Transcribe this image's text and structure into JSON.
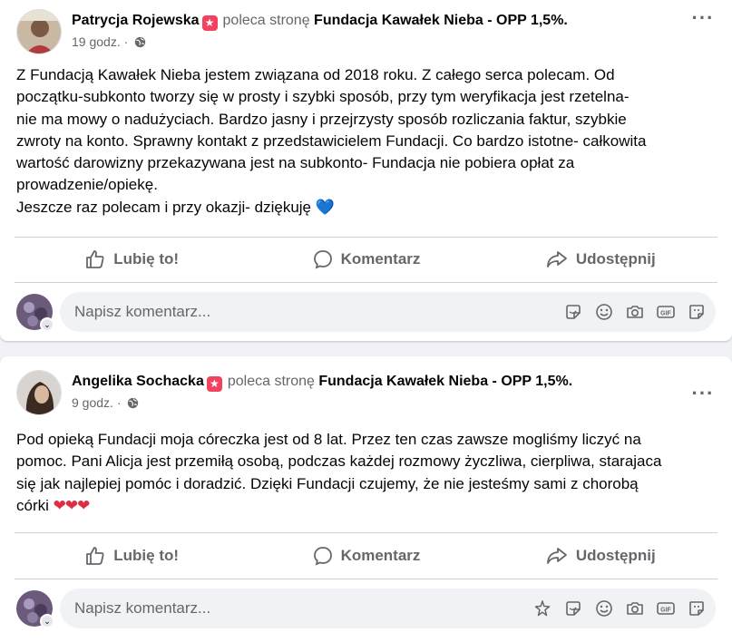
{
  "colors": {
    "background": "#f0f2f5",
    "card": "#ffffff",
    "text_primary": "#050505",
    "text_secondary": "#65676b",
    "badge": "#f3425f",
    "divider": "#ced0d4"
  },
  "posts": [
    {
      "author": "Patrycja Rojewska",
      "recommends_text": "poleca stronę",
      "page_name": "Fundacja Kawałek Nieba - OPP 1,5%.",
      "time": "19 godz. ·",
      "body_lines": [
        "Z Fundacją Kawałek Nieba jestem związana od 2018 roku. Z całego serca polecam. Od",
        "początku-subkonto tworzy się w prosty i szybki sposób, przy tym weryfikacja jest rzetelna-",
        "nie ma mowy o nadużyciach. Bardzo jasny i przejrzysty sposób rozliczania faktur, szybkie",
        "zwroty na konto. Sprawny kontakt z przedstawicielem Fundacji. Co bardzo istotne- całkowita",
        "wartość darowizny przekazywana jest na subkonto- Fundacja nie pobiera opłat za",
        "prowadzenie/opiekę.",
        "Jeszcze raz polecam i przy okazji- dziękuję"
      ],
      "emoji": "💙",
      "actions": {
        "like": "Lubię to!",
        "comment": "Komentarz",
        "share": "Udostępnij"
      },
      "comment_placeholder": "Napisz komentarz...",
      "comment_icons": [
        "sticker-icon",
        "emoji-icon",
        "camera-icon",
        "gif-icon",
        "avatar-sticker-icon"
      ]
    },
    {
      "author": "Angelika Sochacka",
      "recommends_text": "poleca stronę",
      "page_name": "Fundacja Kawałek Nieba - OPP 1,5%.",
      "time": "9 godz. ·",
      "body_lines": [
        "Pod opieką Fundacji moja córeczka jest od 8 lat. Przez ten czas zawsze mogliśmy liczyć na",
        "pomoc. Pani Alicja jest przemiłą osobą, podczas każdej rozmowy życzliwa, cierpliwa, starajaca",
        "się jak najlepiej pomóc i doradzić. Dzięki Fundacji czujemy, że nie jesteśmy sami z chorobą",
        "córki"
      ],
      "emoji": "❤❤❤",
      "actions": {
        "like": "Lubię to!",
        "comment": "Komentarz",
        "share": "Udostępnij"
      },
      "comment_placeholder": "Napisz komentarz...",
      "comment_icons": [
        "spark-icon",
        "sticker-icon",
        "emoji-icon",
        "camera-icon",
        "gif-icon",
        "avatar-sticker-icon"
      ]
    }
  ]
}
